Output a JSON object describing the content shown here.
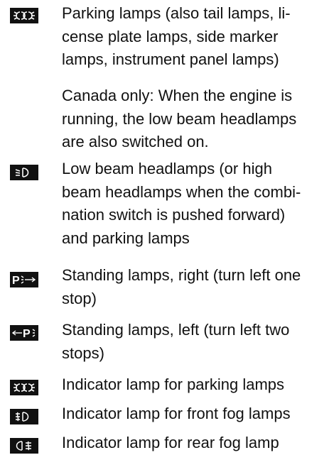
{
  "entries": [
    {
      "icon": "parking-lamps-icon",
      "text": "Parking lamps (also tail lamps, li-\ncense plate lamps, side marker\nlamps, instrument panel lamps)"
    },
    {
      "icon": "",
      "text": "Canada only: When the engine is\nrunning, the low beam headlamps\nare also switched on."
    },
    {
      "icon": "low-beam-headlamps-icon",
      "text": "Low beam headlamps (or high\nbeam headlamps when the combi-\nnation switch is pushed forward)\nand parking lamps"
    },
    {
      "icon": "standing-lamps-right-icon",
      "text": "Standing lamps, right (turn left one\nstop)"
    },
    {
      "icon": "standing-lamps-left-icon",
      "text": "Standing lamps, left (turn left two\nstops)"
    },
    {
      "icon": "parking-lamps-indicator-icon",
      "text": "Indicator lamp for parking lamps"
    },
    {
      "icon": "front-fog-lamp-indicator-icon",
      "text": "Indicator lamp for front fog lamps"
    },
    {
      "icon": "rear-fog-lamp-indicator-icon",
      "text": "Indicator lamp for rear fog lamp"
    }
  ]
}
